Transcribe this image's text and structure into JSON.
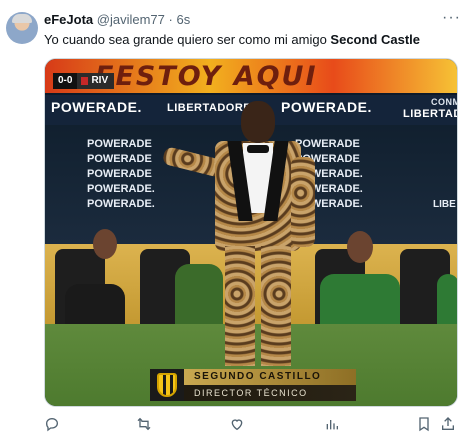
{
  "tweet": {
    "author_name": "eFeJota",
    "author_handle": "@javilem77",
    "separator": "·",
    "time": "6s",
    "text_prefix": "Yo cuando sea grande quiero ser como mi amigo ",
    "text_bold": "Second Castle",
    "more_label": "···"
  },
  "media": {
    "banner_text": "FESTOY AQUI",
    "score": "0-0",
    "team": "RIV",
    "ads": {
      "powerade_1": "POWERADE.",
      "libertad_1": "LIBERTADORES",
      "powerade_2": "POWERADE.",
      "libertad_2": "LIBERTAD",
      "conmebol": "CONMEBOL"
    },
    "stack_left": [
      "POWERADE",
      "POWERADE",
      "POWERADE",
      "POWERADE.",
      "POWERADE."
    ],
    "stack_right": [
      "POWERADE",
      "POWERADE",
      "POWERADE.",
      "POWERADE.",
      "POWERADE."
    ],
    "lib_right": "LIBE",
    "caption_name": "SEGUNDO CASTILLO",
    "caption_role": "DIRECTOR TÉCNICO"
  },
  "actions": [
    {
      "name": "reply-icon"
    },
    {
      "name": "retweet-icon"
    },
    {
      "name": "like-icon"
    },
    {
      "name": "views-icon"
    },
    {
      "name": "bookmark-icon"
    },
    {
      "name": "share-icon"
    }
  ]
}
